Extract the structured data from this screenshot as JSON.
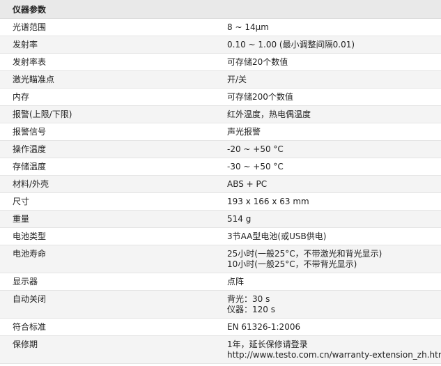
{
  "header": {
    "title": "仪器参数"
  },
  "rows": [
    {
      "label": "光谱范围",
      "values": [
        "8 ~ 14μm"
      ]
    },
    {
      "label": "发射率",
      "values": [
        "0.10 ~ 1.00 (最小调整间隔0.01)"
      ]
    },
    {
      "label": "发射率表",
      "values": [
        "可存储20个数值"
      ]
    },
    {
      "label": "激光瞄准点",
      "values": [
        " 开/关"
      ]
    },
    {
      "label": "内存",
      "values": [
        "可存储200个数值"
      ]
    },
    {
      "label": "报警(上限/下限)",
      "values": [
        "红外温度，热电偶温度"
      ]
    },
    {
      "label": "报警信号",
      "values": [
        "声光报警"
      ]
    },
    {
      "label": "操作温度",
      "values": [
        "-20 ~ +50 °C"
      ]
    },
    {
      "label": "存储温度",
      "values": [
        "-30 ~ +50 °C"
      ]
    },
    {
      "label": "材料/外壳",
      "values": [
        "ABS + PC"
      ]
    },
    {
      "label": "尺寸",
      "values": [
        "193 x 166 x 63 mm"
      ]
    },
    {
      "label": "重量",
      "values": [
        "514 g"
      ]
    },
    {
      "label": "电池类型",
      "values": [
        "3节AA型电池(或USB供电)"
      ]
    },
    {
      "label": "电池寿命",
      "values": [
        "25小时(一般25°C，不带激光和背光显示)",
        "10小时(一般25°C，不带背光显示)"
      ]
    },
    {
      "label": "显示器",
      "values": [
        "点阵"
      ]
    },
    {
      "label": "自动关闭",
      "values": [
        "背光：30 s",
        "仪器：120 s"
      ]
    },
    {
      "label": "符合标准",
      "values": [
        "EN 61326-1:2006"
      ]
    },
    {
      "label": "保修期",
      "values": [
        "1年，延长保修请登录",
        "http://www.testo.com.cn/warranty-extension_zh.html"
      ]
    }
  ]
}
